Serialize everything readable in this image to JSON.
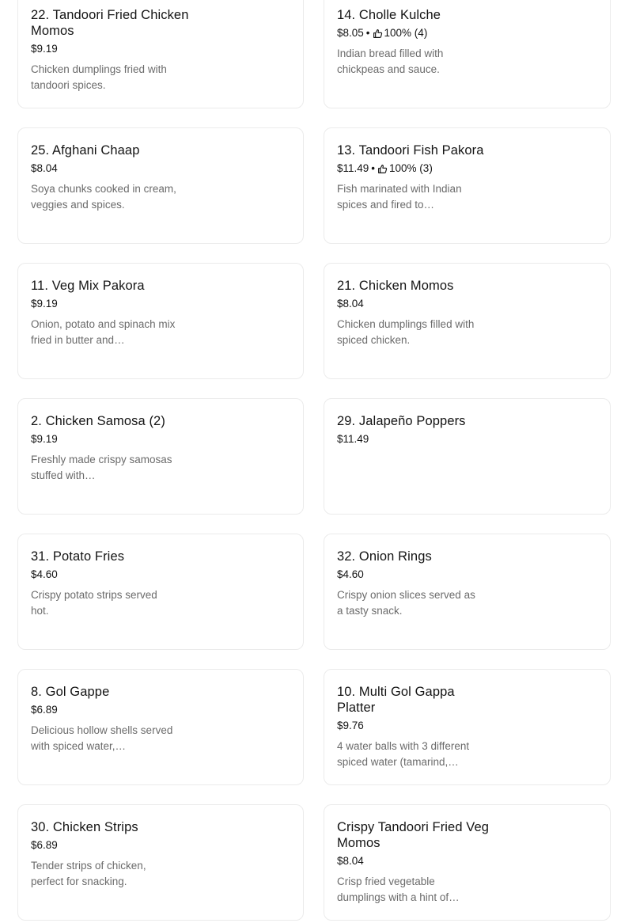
{
  "menu_items": [
    {
      "name": "22. Tandoori Fried Chicken Momos",
      "price": "$9.19",
      "rating": "",
      "description": "Chicken dumplings fried with tandoori spices."
    },
    {
      "name": "14. Cholle Kulche",
      "price": "$8.05",
      "rating": "100% (4)",
      "description": "Indian bread filled with chickpeas and sauce."
    },
    {
      "name": "25. Afghani Chaap",
      "price": "$8.04",
      "rating": "",
      "description": "Soya chunks cooked in cream, veggies and spices."
    },
    {
      "name": "13. Tandoori Fish Pakora",
      "price": "$11.49",
      "rating": "100% (3)",
      "description": "Fish marinated with Indian spices and fired to…"
    },
    {
      "name": "11. Veg Mix Pakora",
      "price": "$9.19",
      "rating": "",
      "description": "Onion, potato and spinach mix fried in butter and…"
    },
    {
      "name": "21. Chicken Momos",
      "price": "$8.04",
      "rating": "",
      "description": "Chicken dumplings filled with spiced chicken."
    },
    {
      "name": "2. Chicken Samosa (2)",
      "price": "$9.19",
      "rating": "",
      "description": "Freshly made crispy samosas stuffed with…"
    },
    {
      "name": "29. Jalapeño Poppers",
      "price": "$11.49",
      "rating": "",
      "description": ""
    },
    {
      "name": "31. Potato Fries",
      "price": "$4.60",
      "rating": "",
      "description": "Crispy potato strips served hot."
    },
    {
      "name": "32. Onion Rings",
      "price": "$4.60",
      "rating": "",
      "description": "Crispy onion slices served as a tasty snack."
    },
    {
      "name": "8. Gol Gappe",
      "price": "$6.89",
      "rating": "",
      "description": "Delicious hollow shells served with spiced water,…"
    },
    {
      "name": "10. Multi Gol Gappa Platter",
      "price": "$9.76",
      "rating": "",
      "description": "4 water balls with 3 different spiced water (tamarind,…"
    },
    {
      "name": "30. Chicken Strips",
      "price": "$6.89",
      "rating": "",
      "description": "Tender strips of chicken, perfect for snacking."
    },
    {
      "name": "Crispy Tandoori Fried Veg Momos",
      "price": "$8.04",
      "rating": "",
      "description": "Crisp fried vegetable dumplings with a hint of…"
    }
  ],
  "rating_separator": "•",
  "rating_icon": "thumbs-up-icon"
}
